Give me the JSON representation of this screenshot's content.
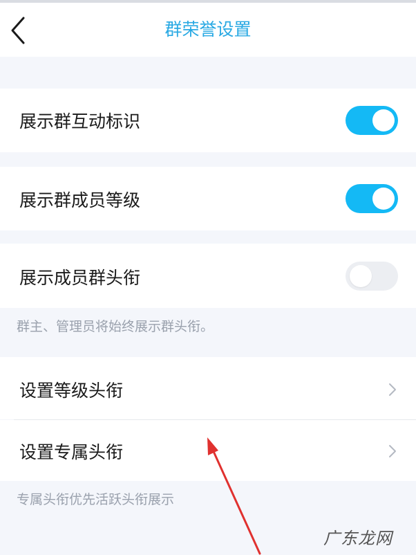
{
  "header": {
    "title": "群荣誉设置",
    "back_icon": "chevron-left-icon"
  },
  "settings": {
    "show_interaction_mark": {
      "label": "展示群互动标识",
      "enabled": true
    },
    "show_member_level": {
      "label": "展示群成员等级",
      "enabled": true
    },
    "show_member_title": {
      "label": "展示成员群头衔",
      "enabled": false
    },
    "title_note": "群主、管理员将始终展示群头衔。",
    "set_level_title": {
      "label": "设置等级头衔",
      "icon": "chevron-right-icon"
    },
    "set_exclusive_title": {
      "label": "设置专属头衔",
      "icon": "chevron-right-icon"
    },
    "exclusive_note": "专属头衔优先活跃头衔展示"
  },
  "watermark": "广东龙网",
  "colors": {
    "accent": "#14b9f5",
    "title": "#29a9e3",
    "annotation_arrow": "#e0312f"
  }
}
